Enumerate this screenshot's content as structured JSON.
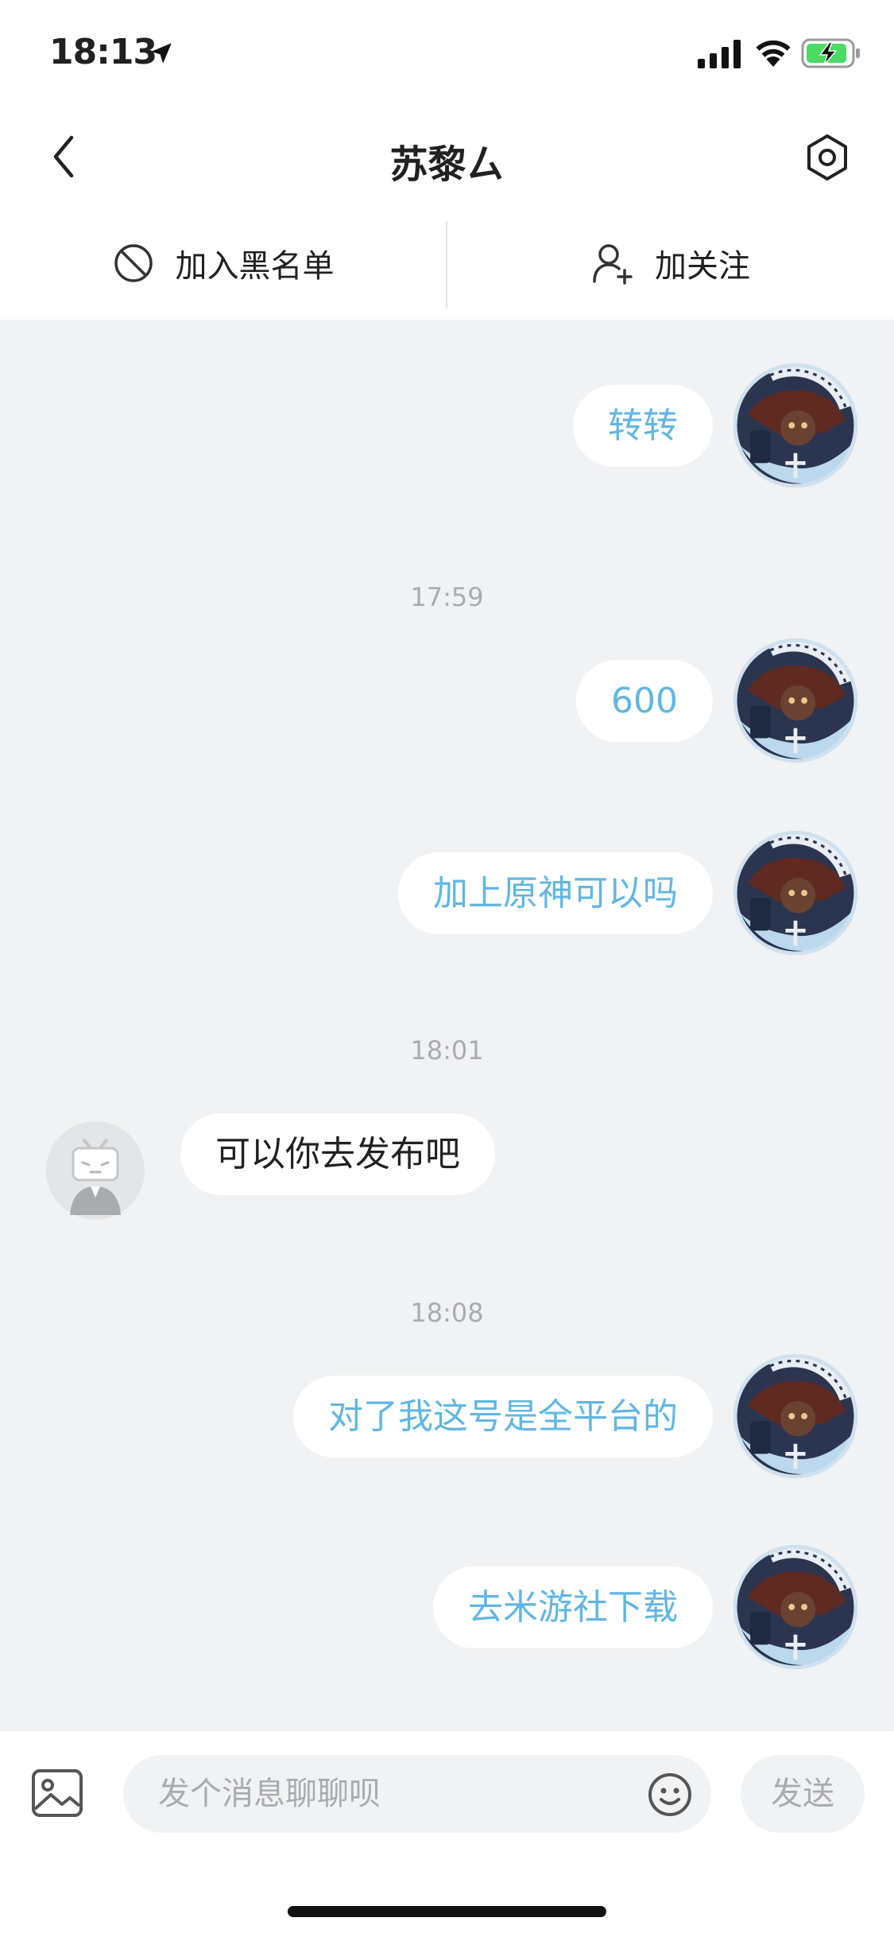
{
  "status_bar": {
    "time": "18:13",
    "icons": [
      "location-arrow-icon",
      "cellular-signal-icon",
      "wifi-icon",
      "battery-charging-icon"
    ]
  },
  "nav": {
    "title": "苏黎ㄙ",
    "back_icon": "chevron-left-icon",
    "settings_icon": "hexagon-settings-icon"
  },
  "actions": {
    "block_label": "加入黑名单",
    "block_icon": "prohibited-icon",
    "follow_label": "加关注",
    "follow_icon": "user-add-icon"
  },
  "messages": [
    {
      "side": "self",
      "text": "转转"
    },
    {
      "timestamp": "17:59"
    },
    {
      "side": "self",
      "text": "600"
    },
    {
      "side": "self",
      "text": "加上原神可以吗"
    },
    {
      "timestamp": "18:01"
    },
    {
      "side": "other",
      "text": "可以你去发布吧"
    },
    {
      "timestamp": "18:08"
    },
    {
      "side": "self",
      "text": "对了我这号是全平台的"
    },
    {
      "side": "self",
      "text": "去米游社下载"
    }
  ],
  "input": {
    "placeholder": "发个消息聊聊呗",
    "value": "",
    "image_icon": "image-icon",
    "emoji_icon": "emoji-icon",
    "send_label": "发送"
  },
  "colors": {
    "chat_background": "#f1f2f3",
    "self_text": "#61b6e3",
    "other_text": "#212121",
    "timestamp_text": "#a9abae",
    "battery_green": "#4cd964"
  }
}
